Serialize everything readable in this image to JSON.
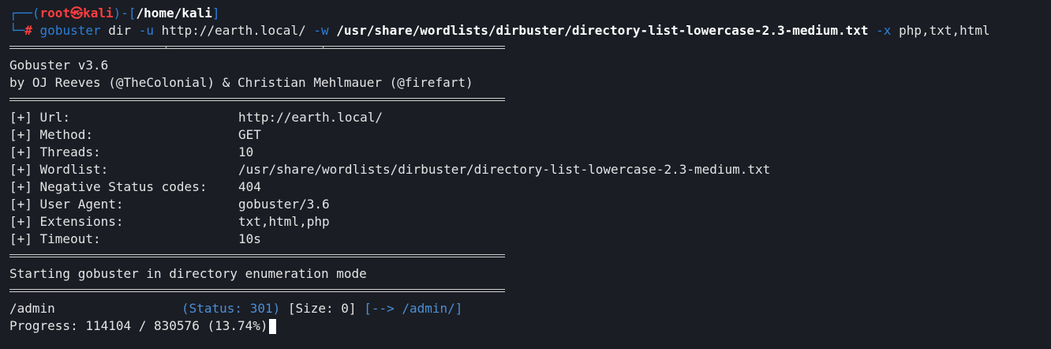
{
  "prompt": {
    "corner_top": "┌──(",
    "user": "root",
    "at": "㉿",
    "host": "kali",
    "close": ")-[",
    "cwd": "/home/kali",
    "close2": "]",
    "corner_bottom": "└─",
    "hash": "#"
  },
  "command": {
    "program": "gobuster",
    "sub": " dir ",
    "flag_u": "-u",
    "url": " http://earth.local/ ",
    "flag_w": "-w",
    "wordlist": " /usr/share/wordlists/dirbuster/directory-list-lowercase-2.3-medium.txt ",
    "flag_x": "-x",
    "ext": " php,txt,html"
  },
  "banner": {
    "title": "Gobuster v3.6",
    "authors": "by OJ Reeves (@TheColonial) & Christian Mehlmauer (@firefart)"
  },
  "config": [
    {
      "key": "[+] Url:",
      "value": "http://earth.local/"
    },
    {
      "key": "[+] Method:",
      "value": "GET"
    },
    {
      "key": "[+] Threads:",
      "value": "10"
    },
    {
      "key": "[+] Wordlist:",
      "value": "/usr/share/wordlists/dirbuster/directory-list-lowercase-2.3-medium.txt"
    },
    {
      "key": "[+] Negative Status codes:",
      "value": "404"
    },
    {
      "key": "[+] User Agent:",
      "value": "gobuster/3.6"
    },
    {
      "key": "[+] Extensions:",
      "value": "txt,html,php"
    },
    {
      "key": "[+] Timeout:",
      "value": "10s"
    }
  ],
  "start_msg": "Starting gobuster in directory enumeration mode",
  "result": {
    "path": "/admin",
    "status": "(Status: 301)",
    "size": " [Size: 0] ",
    "redirect": "[--> /admin/]"
  },
  "progress": {
    "text": "Progress: 114104 / 830576 (13.74%)"
  },
  "colors": {
    "background": "#1a1d24",
    "prompt_blue": "#2b7fd8",
    "root_red": "#ff3e3e",
    "status_blue": "#4c8fd6"
  }
}
